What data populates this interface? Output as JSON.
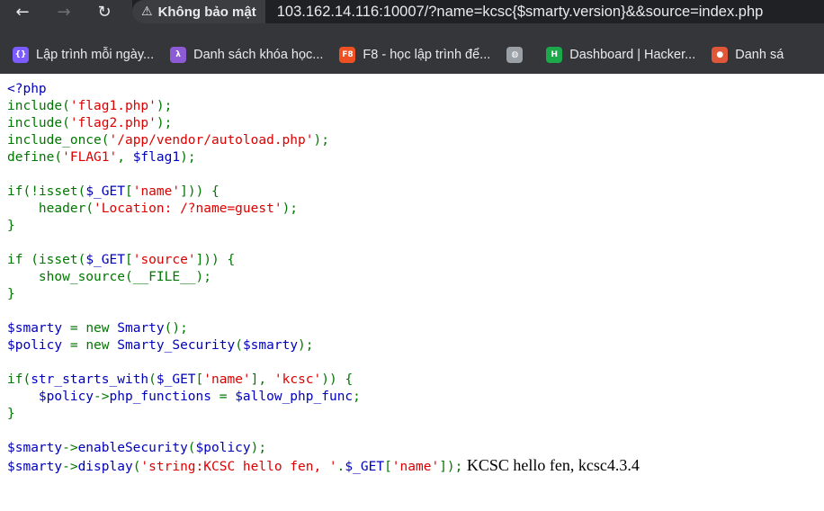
{
  "browser": {
    "security_label": "Không bảo mật",
    "url": "103.162.14.116:10007/?name=kcsc{$smarty.version}&&source=index.php",
    "bookmarks": [
      {
        "label": "Lập trình mỗi ngày...",
        "icon": "braces-icon",
        "color": "#7c5cff"
      },
      {
        "label": "Danh sách khóa học...",
        "icon": "lambda-icon",
        "color": "#8e5bd6"
      },
      {
        "label": "F8 - học lập trình để...",
        "icon": "f8-logo-icon",
        "color": "#f05123"
      },
      {
        "label": "",
        "icon": "globe-icon",
        "color": "#9aa0a6"
      },
      {
        "label": "Dashboard | Hacker...",
        "icon": "hackerrank-icon",
        "color": "#1ba94c"
      },
      {
        "label": "Danh sá",
        "icon": "person-icon",
        "color": "#e0563b"
      }
    ]
  },
  "source": {
    "lines": [
      "<?php",
      "include('flag1.php');",
      "include('flag2.php');",
      "include_once('/app/vendor/autoload.php');",
      "define('FLAG1', $flag1);",
      "",
      "if(!isset($_GET['name'])) {",
      "    header('Location: /?name=guest');",
      "}",
      "",
      "if (isset($_GET['source'])) {",
      "    show_source(__FILE__);",
      "}",
      "",
      "$smarty = new Smarty();",
      "$policy = new Smarty_Security($smarty);",
      "",
      "if(str_starts_with($_GET['name'], 'kcsc')) {",
      "    $policy->php_functions = $allow_php_func;",
      "}",
      "",
      "$smarty->enableSecurity($policy);",
      "$smarty->display('string:KCSC hello fen, '.$_GET['name']);"
    ],
    "output": "KCSC hello fen, kcsc4.3.4"
  },
  "colors": {
    "default": "#0000bb",
    "keyword": "#007700",
    "string": "#dd0000"
  }
}
